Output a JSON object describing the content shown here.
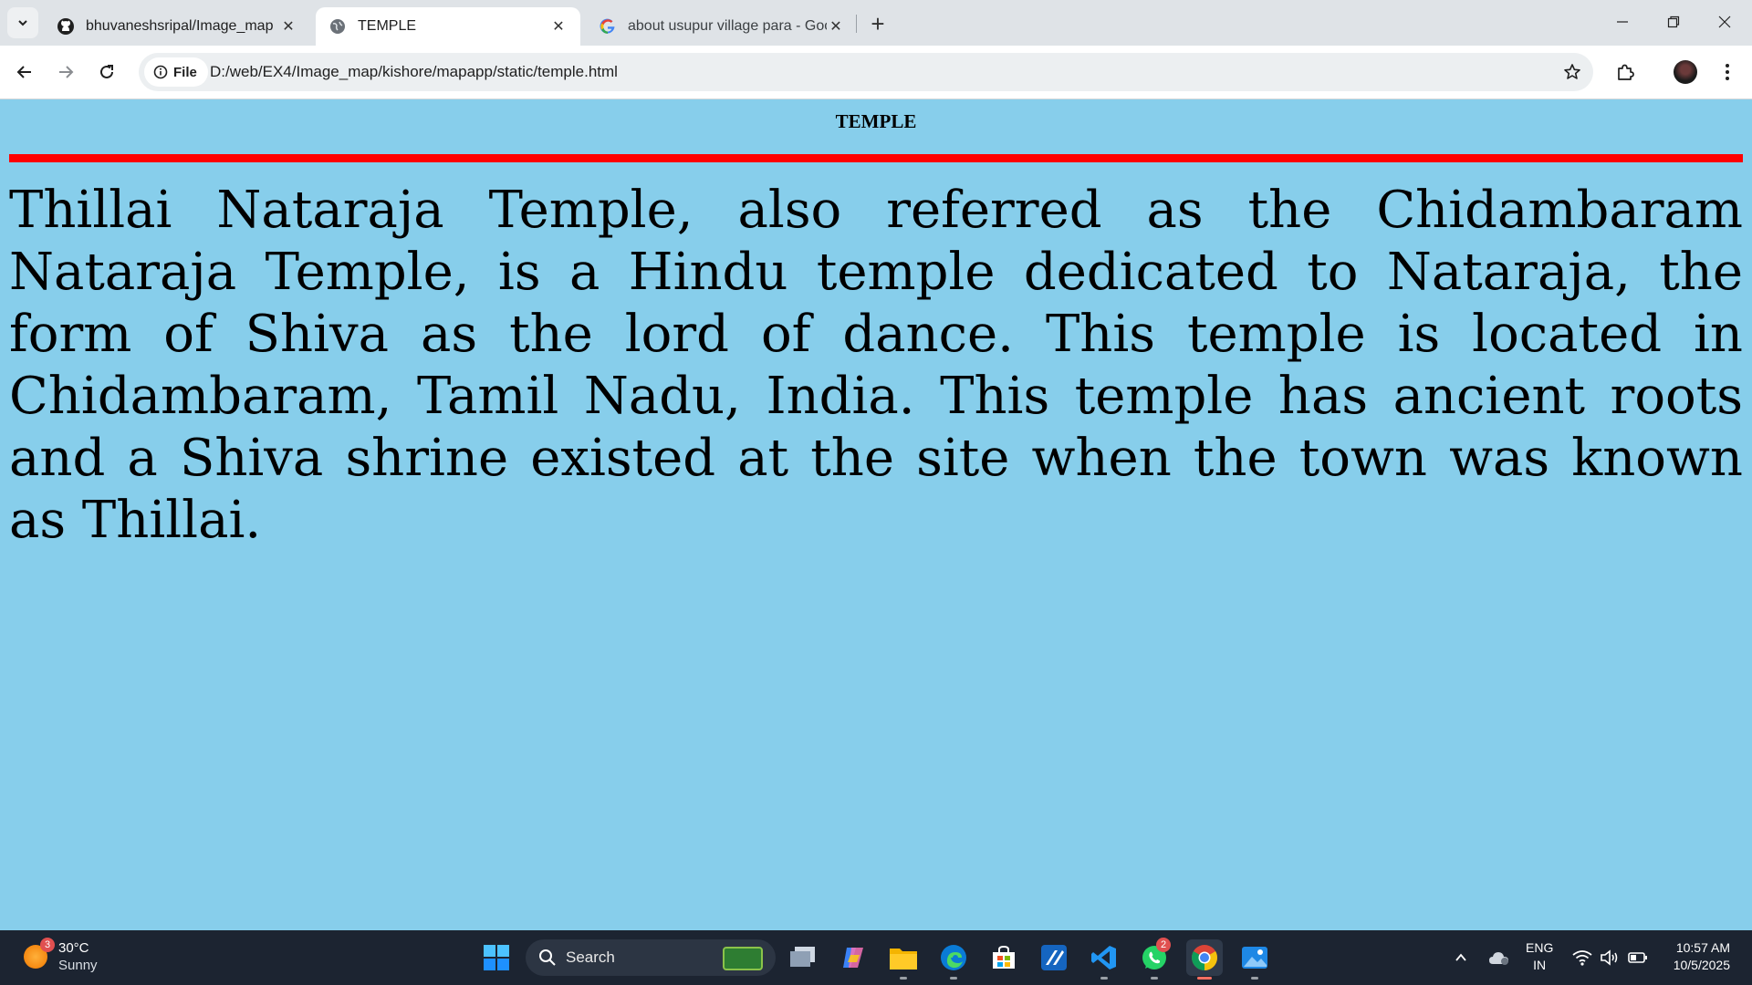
{
  "browser": {
    "tabs": [
      {
        "title": "bhuvaneshsripal/Image_map",
        "icon": "github-icon"
      },
      {
        "title": "TEMPLE",
        "icon": "globe-icon",
        "active": true
      },
      {
        "title": "about usupur village para - Goo",
        "icon": "google-icon"
      }
    ],
    "address": {
      "chip_label": "File",
      "url": "D:/web/EX4/Image_map/kishore/mapapp/static/temple.html"
    }
  },
  "page": {
    "heading": "TEMPLE",
    "paragraph": "Thillai Nataraja Temple, also referred as the Chidambaram Nataraja Temple, is a Hindu temple dedicated to Nataraja, the form of Shiva as the lord of dance. This temple is located in Chidambaram, Tamil Nadu, India. This temple has ancient roots and a Shiva shrine existed at the site when the town was known as Thillai.",
    "background_color": "#87ceeb",
    "rule_color": "#ff0000"
  },
  "taskbar": {
    "weather": {
      "temp": "30°C",
      "condition": "Sunny",
      "badge": "3"
    },
    "search_label": "Search",
    "whatsapp_badge": "2",
    "lang_line1": "ENG",
    "lang_line2": "IN",
    "time": "10:57 AM",
    "date": "10/5/2025"
  }
}
